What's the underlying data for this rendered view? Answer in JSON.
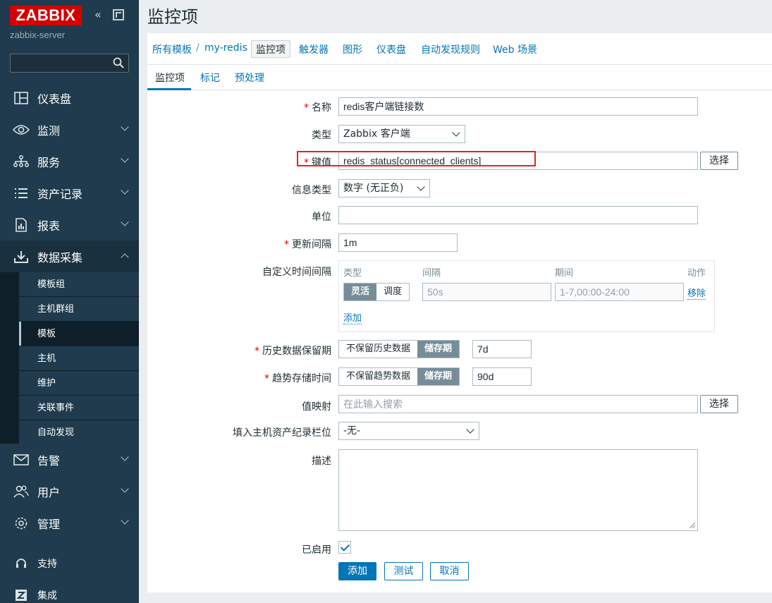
{
  "sidebar": {
    "logo": "ZABBIX",
    "server": "zabbix-server",
    "nav": [
      {
        "label": "仪表盘"
      },
      {
        "label": "监测"
      },
      {
        "label": "服务"
      },
      {
        "label": "资产记录"
      },
      {
        "label": "报表"
      },
      {
        "label": "数据采集"
      },
      {
        "label": "告警"
      },
      {
        "label": "用户"
      },
      {
        "label": "管理"
      }
    ],
    "sub": [
      "模板组",
      "主机群组",
      "模板",
      "主机",
      "维护",
      "关联事件",
      "自动发现"
    ],
    "support": "支持",
    "integrations": "集成"
  },
  "page": {
    "title": "监控项"
  },
  "breadcrumb": {
    "all_templates": "所有模板",
    "sep": "/",
    "template": "my-redis",
    "items": "监控项",
    "triggers": "触发器",
    "graphs": "图形",
    "dashboards": "仪表盘",
    "discovery": "自动发现规则",
    "web": "Web 场景"
  },
  "tabs": {
    "item": "监控项",
    "tags": "标记",
    "preprocessing": "预处理"
  },
  "form": {
    "required": "*",
    "name_label": "名称",
    "name_value": "redis客户端链接数",
    "type_label": "类型",
    "type_value": "Zabbix 客户端",
    "key_label": "键值",
    "key_value": "redis_status[connected_clients]",
    "select_btn": "选择",
    "info_type_label": "信息类型",
    "info_type_value": "数字 (无正负)",
    "units_label": "单位",
    "units_value": "",
    "interval_label": "更新间隔",
    "interval_value": "1m",
    "custom_label": "自定义时间间隔",
    "custom_head_type": "类型",
    "custom_head_interval": "间隔",
    "custom_head_period": "期间",
    "custom_head_action": "动作",
    "custom_flexible": "灵活",
    "custom_scheduling": "调度",
    "custom_interval_ph": "50s",
    "custom_period_ph": "1-7,00:00-24:00",
    "custom_remove": "移除",
    "custom_add": "添加",
    "history_label": "历史数据保留期",
    "history_off": "不保留历史数据",
    "history_on": "储存期",
    "history_value": "7d",
    "trends_label": "趋势存储时间",
    "trends_off": "不保留趋势数据",
    "trends_on": "储存期",
    "trends_value": "90d",
    "valuemap_label": "值映射",
    "valuemap_ph": "在此输入搜索",
    "inventory_label": "填入主机资产纪录栏位",
    "inventory_value": "-无-",
    "desc_label": "描述",
    "enabled_label": "已启用",
    "add_btn": "添加",
    "test_btn": "测试",
    "cancel_btn": "取消"
  },
  "colors": {
    "sidebar": "#1f3b4d",
    "accent": "#0275b8",
    "logo": "#d40000",
    "highlight": "#e1261c"
  }
}
